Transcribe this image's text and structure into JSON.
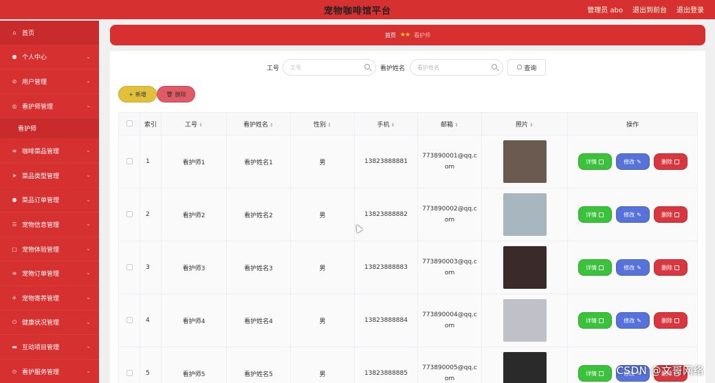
{
  "app": {
    "title": "宠物咖啡馆平台"
  },
  "header": {
    "links": [
      "管理员 abo",
      "退出到前台",
      "退出登录"
    ]
  },
  "sidebar": {
    "items": [
      {
        "label": "首页",
        "icon": "home-icon",
        "glyph": "⌂"
      },
      {
        "label": "个人中心",
        "icon": "user-icon",
        "glyph": "●"
      },
      {
        "label": "用户管理",
        "icon": "users-icon",
        "glyph": "⊘"
      },
      {
        "label": "看护师管理",
        "icon": "nurse-icon",
        "glyph": "◎"
      },
      {
        "label": "看护师",
        "sub": true
      },
      {
        "label": "咖啡菜品管理",
        "icon": "menu-icon",
        "glyph": "≡"
      },
      {
        "label": "菜品类型管理",
        "icon": "send-icon",
        "glyph": "➤"
      },
      {
        "label": "菜品订单管理",
        "icon": "person-icon",
        "glyph": "●"
      },
      {
        "label": "宠物信息管理",
        "icon": "filter-icon",
        "glyph": "☰"
      },
      {
        "label": "宠物体验管理",
        "icon": "frame-icon",
        "glyph": "□"
      },
      {
        "label": "宠物订单管理",
        "icon": "list-icon",
        "glyph": "≡"
      },
      {
        "label": "宠物寄养管理",
        "icon": "plane-icon",
        "glyph": "✈"
      },
      {
        "label": "健康状况管理",
        "icon": "power-icon",
        "glyph": "⏻"
      },
      {
        "label": "互动项目管理",
        "icon": "box-icon",
        "glyph": "▬"
      },
      {
        "label": "看护服务管理",
        "icon": "compass-icon",
        "glyph": "⊙"
      }
    ]
  },
  "breadcrumb": {
    "home": "首页",
    "stars": "★★",
    "current": "看护师"
  },
  "search": {
    "id_label": "工号",
    "id_placeholder": "工号",
    "name_label": "看护姓名",
    "name_placeholder": "看护姓名",
    "query_label": "查询"
  },
  "toolbar": {
    "add_label": "新增",
    "delete_label": "删除"
  },
  "table": {
    "headers": [
      "索引",
      "工号",
      "看护姓名",
      "性别",
      "手机",
      "邮箱",
      "照片",
      "操作"
    ],
    "rows": [
      {
        "index": "1",
        "id": "看护师1",
        "name": "看护姓名1",
        "gender": "男",
        "phone": "13823888881",
        "email": "773890001@qq.com",
        "photo_color": "#6a5a50"
      },
      {
        "index": "2",
        "id": "看护师2",
        "name": "看护姓名2",
        "gender": "男",
        "phone": "13823888882",
        "email": "773890002@qq.com",
        "photo_color": "#a8b6c0"
      },
      {
        "index": "3",
        "id": "看护师3",
        "name": "看护姓名3",
        "gender": "男",
        "phone": "13823888883",
        "email": "773890003@qq.com",
        "photo_color": "#3a2a2a"
      },
      {
        "index": "4",
        "id": "看护师4",
        "name": "看护姓名4",
        "gender": "男",
        "phone": "13823888884",
        "email": "773890004@qq.com",
        "photo_color": "#c0c0c8"
      },
      {
        "index": "5",
        "id": "看护师5",
        "name": "看护姓名5",
        "gender": "男",
        "phone": "13823888885",
        "email": "773890005@qq.com",
        "photo_color": "#2a2a2a"
      }
    ],
    "actions": {
      "detail": "详情",
      "edit": "修改",
      "remove": "删除"
    }
  },
  "watermark": "CSDN @文哥网络",
  "colors": {
    "primary": "#d63031",
    "detail": "#3ac23a",
    "edit": "#5773d9",
    "remove": "#d8373f",
    "add": "#e1c13c"
  }
}
